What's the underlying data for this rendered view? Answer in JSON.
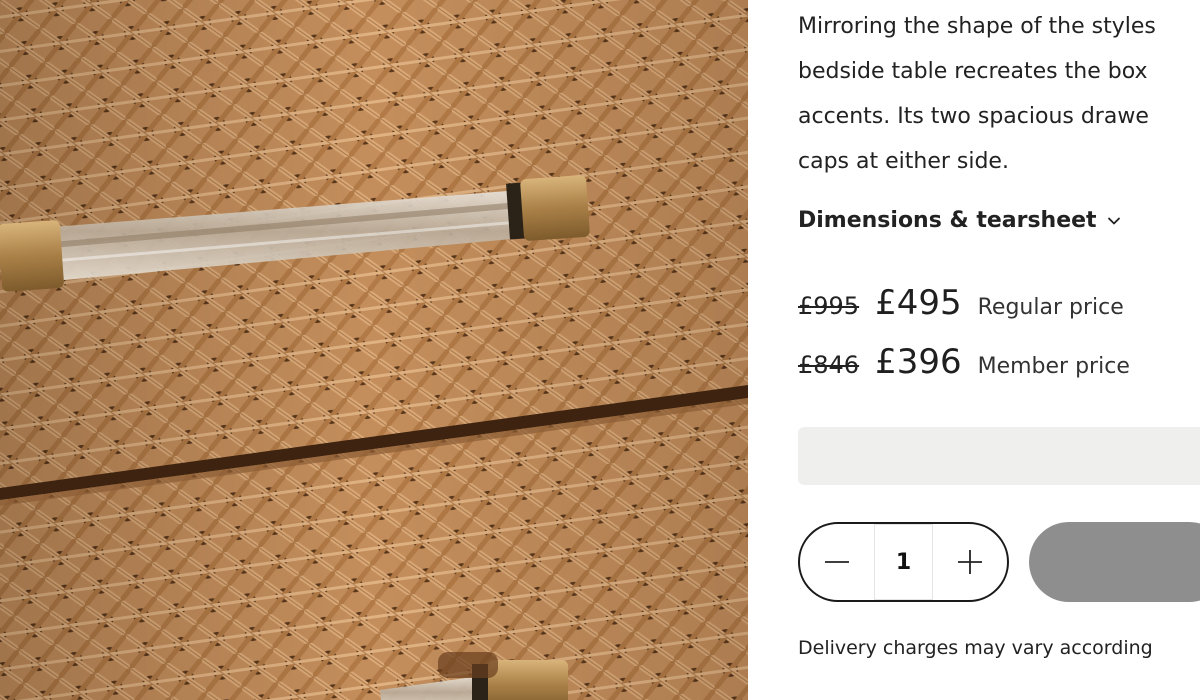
{
  "product_image": {
    "alt": "Close-up of rattan cane drawers with acrylic and brass handles",
    "colors": {
      "cane": "#c08a58",
      "cane_shadow": "#6a4324",
      "hole": "#55341a",
      "brass": "#b08a52",
      "acrylic": "#d7cfc4"
    }
  },
  "description": {
    "lines": [
      "Mirroring the shape of the styles",
      "bedside table recreates the box",
      "accents. Its two spacious drawe",
      "caps at either side."
    ]
  },
  "dimensions": {
    "label": "Dimensions & tearsheet",
    "icon": "chevron-down-icon"
  },
  "prices": {
    "regular": {
      "old": "£995",
      "new": "£495",
      "label": "Regular price"
    },
    "member": {
      "old": "£846",
      "new": "£396",
      "label": "Member price"
    }
  },
  "quantity": {
    "value": "1",
    "decrement_icon": "minus-icon",
    "increment_icon": "plus-icon"
  },
  "delivery": {
    "text": "Delivery charges may vary according"
  },
  "colors": {
    "notice_bar": "#efefed",
    "add_button": "#8e8e8e",
    "stepper_border": "#1a1a1a"
  }
}
